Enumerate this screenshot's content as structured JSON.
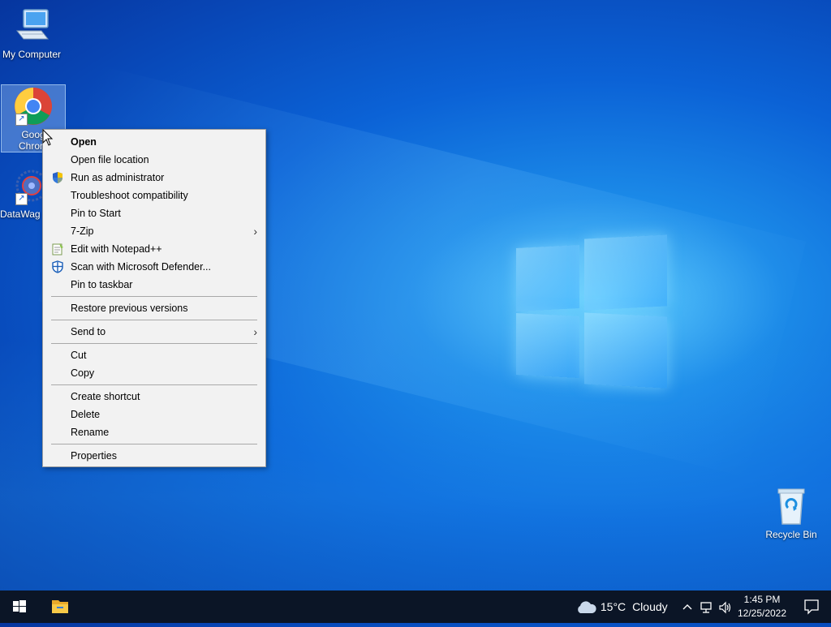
{
  "desktop": {
    "icons": [
      {
        "label": "My Computer"
      },
      {
        "label": "Google Chrome",
        "label_visible": "Goog\nChrom"
      },
      {
        "label": "DataWag"
      },
      {
        "label": "Recycle Bin"
      }
    ]
  },
  "context_menu": {
    "items": [
      {
        "label": "Open"
      },
      {
        "label": "Open file location"
      },
      {
        "label": "Run as administrator"
      },
      {
        "label": "Troubleshoot compatibility"
      },
      {
        "label": "Pin to Start"
      },
      {
        "label": "7-Zip"
      },
      {
        "label": "Edit with Notepad++"
      },
      {
        "label": "Scan with Microsoft Defender..."
      },
      {
        "label": "Pin to taskbar"
      },
      {
        "label": "Restore previous versions"
      },
      {
        "label": "Send to"
      },
      {
        "label": "Cut"
      },
      {
        "label": "Copy"
      },
      {
        "label": "Create shortcut"
      },
      {
        "label": "Delete"
      },
      {
        "label": "Rename"
      },
      {
        "label": "Properties"
      }
    ],
    "submenu_glyph": "›"
  },
  "taskbar": {
    "weather_temp": "15°C",
    "weather_desc": "Cloudy",
    "time": "1:45 PM",
    "date": "12/25/2022",
    "tray_chevron": "^"
  }
}
